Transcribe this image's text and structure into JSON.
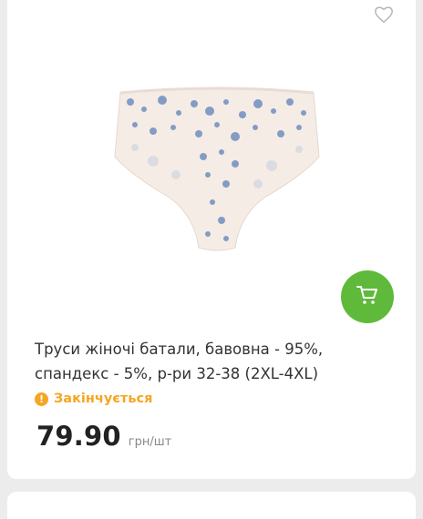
{
  "product": {
    "title": "Труси жіночі батали, бавовна - 95%, спандекс - 5%, р-ри 32-38 (2XL-4XL)",
    "status": "Закінчується",
    "price": "79.90",
    "unit": "грн/шт"
  },
  "colors": {
    "accent_green": "#5fba3b",
    "status_orange": "#f5a623",
    "floral_blue": "#6f8fbf",
    "fabric_cream": "#f6ece6"
  },
  "icons": {
    "favorite": "heart-outline-icon",
    "cart": "cart-icon",
    "status": "exclamation-icon"
  }
}
